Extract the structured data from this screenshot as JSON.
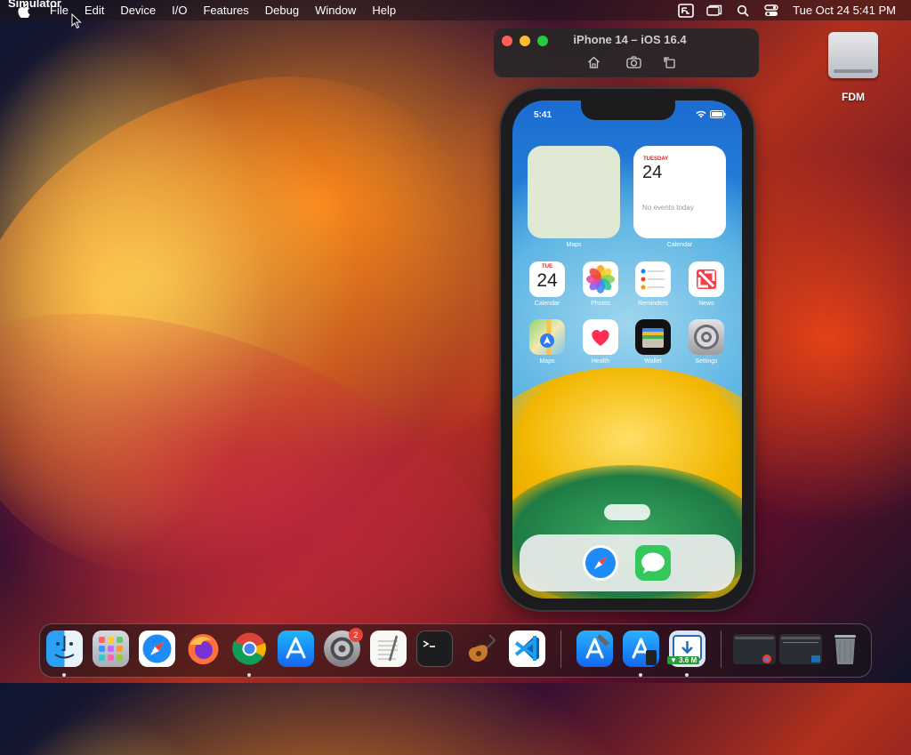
{
  "menubar": {
    "app_name": "Simulator",
    "items": [
      "File",
      "Edit",
      "Device",
      "I/O",
      "Features",
      "Debug",
      "Window",
      "Help"
    ],
    "clock": "Tue Oct 24  5:41 PM"
  },
  "sim_window": {
    "title": "iPhone 14 – iOS 16.4"
  },
  "desktop": {
    "drive_label": "FDM"
  },
  "phone": {
    "time": "5:41",
    "widgets": {
      "maps_label": "Maps",
      "calendar": {
        "day": "TUESDAY",
        "date": "24",
        "events": "No events today",
        "label": "Calendar"
      }
    },
    "apps_row1": [
      {
        "label": "Calendar",
        "icon": "calendar-icon",
        "day": "TUE",
        "date": "24"
      },
      {
        "label": "Photos",
        "icon": "photos-icon"
      },
      {
        "label": "Reminders",
        "icon": "reminders-icon"
      },
      {
        "label": "News",
        "icon": "news-icon"
      }
    ],
    "apps_row2": [
      {
        "label": "Maps",
        "icon": "maps-icon"
      },
      {
        "label": "Health",
        "icon": "health-icon"
      },
      {
        "label": "Wallet",
        "icon": "wallet-icon"
      },
      {
        "label": "Settings",
        "icon": "settings-icon"
      }
    ],
    "dock": [
      "safari-icon",
      "messages-icon"
    ]
  },
  "dock": {
    "apps": [
      "Finder",
      "Launchpad",
      "Safari",
      "Firefox",
      "Chrome",
      "App Store",
      "System Settings",
      "TextEdit",
      "Terminal",
      "Instruments",
      "Visual Studio Code",
      "Xcode",
      "Simulator",
      "Free Download Manager"
    ],
    "settings_badge": "2",
    "net_speed": "3.6 M"
  }
}
